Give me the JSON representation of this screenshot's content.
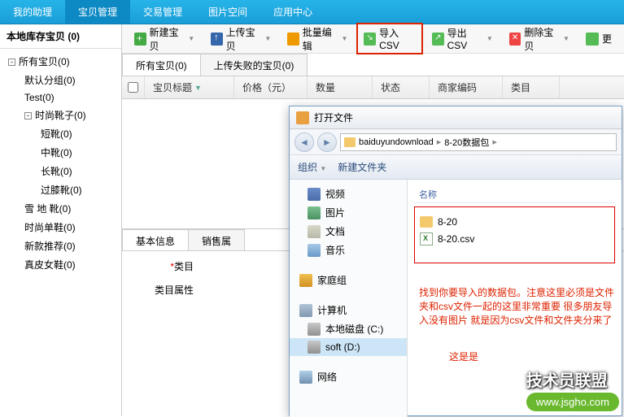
{
  "topnav": {
    "items": [
      "我的助理",
      "宝贝管理",
      "交易管理",
      "图片空间",
      "应用中心"
    ],
    "active": 1
  },
  "sidebar": {
    "header": "本地库存宝贝 (0)",
    "tree": [
      {
        "label": "所有宝贝(0)",
        "level": 1,
        "toggle": "-"
      },
      {
        "label": "默认分组(0)",
        "level": 2
      },
      {
        "label": "Test(0)",
        "level": 2
      },
      {
        "label": "时尚靴子(0)",
        "level": 2,
        "toggle": "-"
      },
      {
        "label": "短靴(0)",
        "level": 3
      },
      {
        "label": "中靴(0)",
        "level": 3
      },
      {
        "label": "长靴(0)",
        "level": 3
      },
      {
        "label": "过膝靴(0)",
        "level": 3
      },
      {
        "label": "雪 地 靴(0)",
        "level": 2
      },
      {
        "label": "时尚单鞋(0)",
        "level": 2
      },
      {
        "label": "新款推荐(0)",
        "level": 2
      },
      {
        "label": "真皮女鞋(0)",
        "level": 2
      }
    ]
  },
  "toolbar": {
    "new": "新建宝贝",
    "upload": "上传宝贝",
    "batch": "批量编辑",
    "import": "导入CSV",
    "export": "导出CSV",
    "delete": "删除宝贝",
    "update": "更"
  },
  "subtabs": {
    "all": "所有宝贝(0)",
    "failed": "上传失败的宝贝(0)"
  },
  "grid": {
    "cols": [
      "宝贝标题",
      "价格（元）",
      "数量",
      "状态",
      "商家编码",
      "类目"
    ]
  },
  "bottomTabs": [
    "基本信息",
    "销售属"
  ],
  "form": {
    "category": "类目",
    "catAttr": "类目属性"
  },
  "dialog": {
    "title": "打开文件",
    "breadcrumb": [
      "baiduyundownload",
      "8-20数据包"
    ],
    "toolbar": {
      "org": "组织",
      "newfolder": "新建文件夹"
    },
    "side": [
      {
        "label": "视频",
        "icon": "si-video"
      },
      {
        "label": "图片",
        "icon": "si-image"
      },
      {
        "label": "文档",
        "icon": "si-doc"
      },
      {
        "label": "音乐",
        "icon": "si-music"
      },
      {
        "label": "家庭组",
        "icon": "si-home",
        "spaced": true
      },
      {
        "label": "计算机",
        "icon": "si-computer",
        "spaced": true
      },
      {
        "label": "本地磁盘 (C:)",
        "icon": "si-disk",
        "indent": true
      },
      {
        "label": "soft (D:)",
        "icon": "si-disk",
        "indent": true,
        "sel": true
      },
      {
        "label": "网络",
        "icon": "si-network",
        "spaced": true
      }
    ],
    "filesHeader": "名称",
    "files": [
      {
        "name": "8-20",
        "type": "folder"
      },
      {
        "name": "8-20.csv",
        "type": "csv"
      }
    ]
  },
  "annotation": "找到你要导入的数据包。注意这里必须是文件夹和csv文件一起的这里非常重要  很多朋友导入没有图片 就是因为csv文件和文件夹分来了",
  "annotation2": "这是是",
  "watermark": {
    "text": "技术员联盟",
    "url": "www.jsgho.com"
  }
}
